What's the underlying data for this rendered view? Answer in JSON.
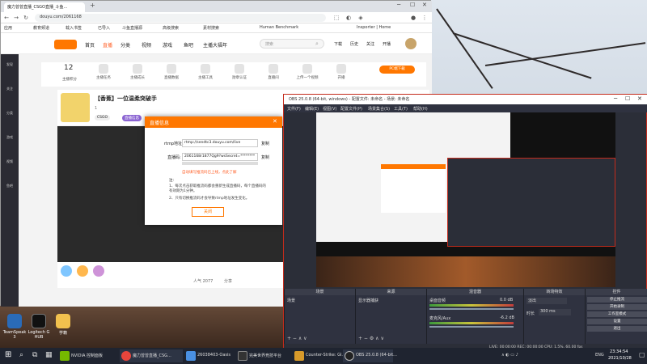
{
  "browser": {
    "tabs": [
      {
        "label": "魔力曾曾直播_CSGO直播_斗鱼..."
      }
    ],
    "new_tab": "+",
    "url": "douyu.com/2061168",
    "bookmarks": [
      "应用",
      "教育频道",
      "载入书签",
      "已导入",
      "斗鱼直播源",
      "高级搜索",
      "素材搜索",
      "Human Benchmark",
      "Insporter | Home"
    ]
  },
  "douyu": {
    "nav": [
      "首页",
      "直播",
      "分类",
      "视频",
      "游戏",
      "鱼吧",
      "主播大福年"
    ],
    "search_placeholder": "搜索",
    "header_right": [
      "下载",
      "历史",
      "关注",
      "开播"
    ],
    "sidebar": [
      "发现",
      "关注",
      "分类",
      "游戏",
      "视频",
      "鱼吧"
    ],
    "categories": [
      {
        "value": "12",
        "label": "主播积分"
      },
      {
        "label": "主播任务"
      },
      {
        "label": "主播成长"
      },
      {
        "label": "直播数据"
      },
      {
        "label": "主播工具"
      },
      {
        "label": "勋章认证"
      },
      {
        "label": "直播间"
      },
      {
        "label": "上传一个视频"
      },
      {
        "label": "开播"
      },
      {
        "label": "PC端下载"
      }
    ],
    "room_title": "【香蕉】一位温柔突破手",
    "room_tags": [
      "CSGO",
      "直播信息"
    ],
    "follow_count": "1",
    "bottom_stats": [
      "人气 2077",
      "分享"
    ]
  },
  "dialog": {
    "title": "直播信息",
    "rtmp_label": "rtmp地址:",
    "rtmp_value": "rtmp://sendtc3.douyu.com/live",
    "code_label": "直播码:",
    "code_value": "2061168r1877Qg9?wsSecret=********",
    "copy1": "复制",
    "copy2": "复制",
    "warning": "自动填写推流码已上线，点此了解",
    "notes_title": "注:",
    "note1": "1、每次点击获取推流码都会重新生成直播码，每个直播码的有效期为1分钟。",
    "note2": "2、只有切换推流码才会导致rtmp地址发生变化。",
    "close_button": "关闭"
  },
  "obs": {
    "title": "OBS 25.0.8 (64-bit, windows) - 配置文件: 未命名 - 场景: 未命名",
    "menu": [
      "文件(F)",
      "编辑(E)",
      "视图(V)",
      "配置文件(P)",
      "场景集合(S)",
      "工具(T)",
      "帮助(H)"
    ],
    "docks": {
      "scenes": {
        "header": "场景",
        "items": [
          "场景"
        ]
      },
      "sources": {
        "header": "来源",
        "items": [
          "显示器捕获"
        ]
      },
      "mixer": {
        "header": "混音器",
        "tracks": [
          {
            "name": "桌面音频",
            "db": "0.0 dB"
          },
          {
            "name": "麦克风/Aux",
            "db": "-6.2 dB"
          }
        ]
      },
      "transitions": {
        "header": "转场特效",
        "type": "淡出",
        "duration_label": "时长",
        "duration": "300 ms"
      },
      "controls": {
        "header": "控件",
        "buttons": [
          "停止推流",
          "开始录制",
          "工作室模式",
          "设置",
          "退出"
        ]
      }
    },
    "status": "LIVE: 00:00:00   REC: 00:00:00   CPU: 1.5%, 60.00 fps"
  },
  "desktop_icons": [
    "TeamSpeak 3",
    "Logitech G HUB",
    "学籍"
  ],
  "taskbar": {
    "items": [
      "NVIDIA 控制面板",
      "魔力曾曾直播_CSG...",
      "26038403-Oasis",
      "完美世界竞技平台",
      "Counter-Strike: Gl...",
      "OBS 25.0.8 (64-bit..."
    ],
    "tray_lang": "ENG",
    "time": "23:34:54",
    "date": "2021/10/28"
  }
}
